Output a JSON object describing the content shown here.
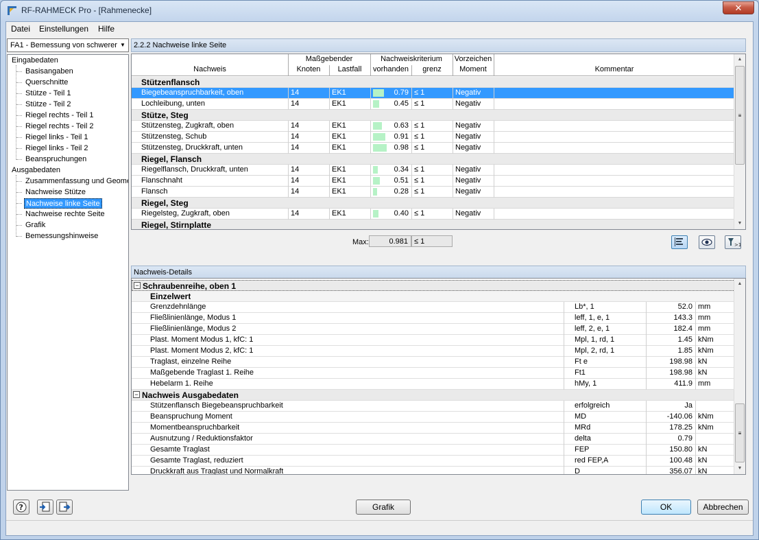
{
  "window": {
    "title": "RF-RAHMECK Pro - [Rahmenecke]",
    "close": "✕"
  },
  "menu": [
    "Datei",
    "Einstellungen",
    "Hilfe"
  ],
  "case_select": "FA1 - Bemessung von schwerer",
  "tree": {
    "input_root": "Eingabedaten",
    "input_items": [
      "Basisangaben",
      "Querschnitte",
      "Stütze - Teil 1",
      "Stütze - Teil 2",
      "Riegel rechts - Teil 1",
      "Riegel rechts - Teil 2",
      "Riegel links - Teil 1",
      "Riegel links - Teil 2",
      "Beanspruchungen"
    ],
    "output_root": "Ausgabedaten",
    "output_items": [
      "Zusammenfassung und Geome",
      "Nachweise Stütze",
      "Nachweise linke Seite",
      "Nachweise rechte Seite",
      "Grafik",
      "Bemessungshinweise"
    ],
    "selected": "Nachweise linke Seite"
  },
  "table": {
    "title": "2.2.2 Nachweise linke Seite",
    "headers": {
      "massgebender": "Maßgebender",
      "nachweis": "Nachweis",
      "knoten": "Knoten",
      "lastfall": "Lastfall",
      "kriterium": "Nachweiskriterium",
      "vorhanden": "vorhanden",
      "grenz": "grenz",
      "vorzeichen": "Vorzeichen",
      "moment": "Moment",
      "kommentar": "Kommentar"
    },
    "groups": [
      {
        "name": "Stützenflansch",
        "rows": [
          {
            "nachweis": "Biegebeanspruchbarkeit, oben",
            "knoten": "14",
            "lastfall": "EK1",
            "value": "0.79",
            "ratio": 0.79,
            "grenz": "≤ 1",
            "vorzeichen": "Negativ",
            "selected": true
          },
          {
            "nachweis": "Lochleibung, unten",
            "knoten": "14",
            "lastfall": "EK1",
            "value": "0.45",
            "ratio": 0.45,
            "grenz": "≤ 1",
            "vorzeichen": "Negativ"
          }
        ]
      },
      {
        "name": "Stütze, Steg",
        "rows": [
          {
            "nachweis": "Stützensteg, Zugkraft, oben",
            "knoten": "14",
            "lastfall": "EK1",
            "value": "0.63",
            "ratio": 0.63,
            "grenz": "≤ 1",
            "vorzeichen": "Negativ"
          },
          {
            "nachweis": "Stützensteg, Schub",
            "knoten": "14",
            "lastfall": "EK1",
            "value": "0.91",
            "ratio": 0.91,
            "grenz": "≤ 1",
            "vorzeichen": "Negativ"
          },
          {
            "nachweis": "Stützensteg, Druckkraft, unten",
            "knoten": "14",
            "lastfall": "EK1",
            "value": "0.98",
            "ratio": 0.98,
            "grenz": "≤ 1",
            "vorzeichen": "Negativ"
          }
        ]
      },
      {
        "name": "Riegel, Flansch",
        "rows": [
          {
            "nachweis": "Riegelflansch, Druckkraft, unten",
            "knoten": "14",
            "lastfall": "EK1",
            "value": "0.34",
            "ratio": 0.34,
            "grenz": "≤ 1",
            "vorzeichen": "Negativ"
          },
          {
            "nachweis": "Flanschnaht",
            "knoten": "14",
            "lastfall": "EK1",
            "value": "0.51",
            "ratio": 0.51,
            "grenz": "≤ 1",
            "vorzeichen": "Negativ"
          },
          {
            "nachweis": "Flansch",
            "knoten": "14",
            "lastfall": "EK1",
            "value": "0.28",
            "ratio": 0.28,
            "grenz": "≤ 1",
            "vorzeichen": "Negativ"
          }
        ]
      },
      {
        "name": "Riegel, Steg",
        "rows": [
          {
            "nachweis": "Riegelsteg, Zugkraft, oben",
            "knoten": "14",
            "lastfall": "EK1",
            "value": "0.40",
            "ratio": 0.4,
            "grenz": "≤ 1",
            "vorzeichen": "Negativ"
          }
        ]
      },
      {
        "name": "Riegel, Stirnplatte",
        "rows": []
      }
    ],
    "max_label": "Max:",
    "max_value": "0.981",
    "max_grenz": "≤ 1"
  },
  "details": {
    "title": "Nachweis-Details",
    "group1": "Schraubenreihe, oben 1",
    "sub1": "Einzelwert",
    "rows1": [
      {
        "label": "Grenzdehnlänge",
        "sym": "Lb*, 1",
        "value": "52.0",
        "unit": "mm"
      },
      {
        "label": "Fließlinienlänge, Modus 1",
        "sym": "leff, 1, e, 1",
        "value": "143.3",
        "unit": "mm"
      },
      {
        "label": "Fließlinienlänge, Modus 2",
        "sym": "leff, 2, e, 1",
        "value": "182.4",
        "unit": "mm"
      },
      {
        "label": "Plast. Moment Modus 1, kfC: 1",
        "sym": "Mpl, 1, rd, 1",
        "value": "1.45",
        "unit": "kNm"
      },
      {
        "label": "Plast. Moment Modus 2, kfC: 1",
        "sym": "Mpl, 2, rd, 1",
        "value": "1.85",
        "unit": "kNm"
      },
      {
        "label": "Traglast, einzelne Reihe",
        "sym": "Ft e",
        "value": "198.98",
        "unit": "kN"
      },
      {
        "label": "Maßgebende Traglast 1. Reihe",
        "sym": "Ft1",
        "value": "198.98",
        "unit": "kN"
      },
      {
        "label": "Hebelarm 1. Reihe",
        "sym": "hMy, 1",
        "value": "411.9",
        "unit": "mm"
      }
    ],
    "group2": "Nachweis Ausgabedaten",
    "rows2": [
      {
        "label": "Stützenflansch Biegebeanspruchbarkeit",
        "sym": "erfolgreich",
        "value": "Ja",
        "unit": ""
      },
      {
        "label": "Beanspruchung Moment",
        "sym": "MD",
        "value": "-140.06",
        "unit": "kNm"
      },
      {
        "label": "Momentbeanspruchbarkeit",
        "sym": "MRd",
        "value": "178.25",
        "unit": "kNm"
      },
      {
        "label": "Ausnutzung / Reduktionsfaktor",
        "sym": "delta",
        "value": "0.79",
        "unit": ""
      },
      {
        "label": "Gesamte Traglast",
        "sym": "FEP",
        "value": "150.80",
        "unit": "kN"
      },
      {
        "label": "Gesamte Traglast, reduziert",
        "sym": "red FEP,A",
        "value": "100.48",
        "unit": "kN"
      },
      {
        "label": "Druckkraft aus Traglast und Normalkraft",
        "sym": "D",
        "value": "356.07",
        "unit": "kN"
      }
    ]
  },
  "buttons": {
    "grafik": "Grafik",
    "ok": "OK",
    "cancel": "Abbrechen"
  },
  "colors": {
    "selection": "#3399ff",
    "bar": "#b6f2c6"
  }
}
